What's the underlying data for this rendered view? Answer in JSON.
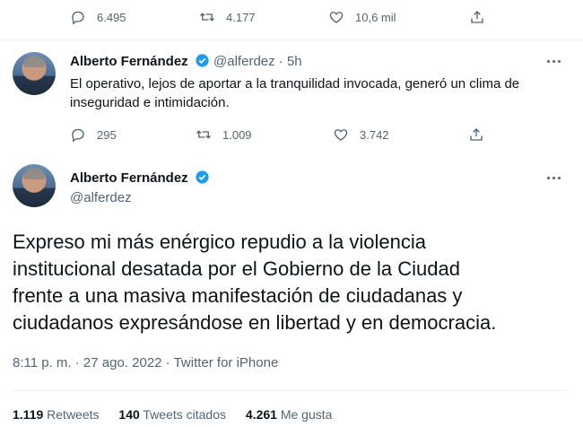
{
  "top_actions": {
    "replies": "6.495",
    "retweets": "4.177",
    "likes": "10,6 mil"
  },
  "reply_tweet": {
    "name": "Alberto Fernández",
    "handle_time": "@alferdez · 5h",
    "text_line1": "El operativo, lejos de aportar a la tranquilidad invocada, generó un clima de",
    "text_line2": "inseguridad e intimidación.",
    "replies": "295",
    "retweets": "1.009",
    "likes": "3.742"
  },
  "main_tweet": {
    "name": "Alberto Fernández",
    "handle": "@alferdez",
    "text_lines": [
      "Expreso mi más enérgico repudio a la violencia",
      "institucional desatada por el Gobierno de la Ciudad",
      "frente a una masiva manifestación de ciudadanas y",
      "ciudadanos expresándose en libertad y en democracia."
    ],
    "timestamp": "8:11 p. m. · 27 ago. 2022 · ",
    "source": "Twitter for iPhone",
    "stats": {
      "retweets_count": "1.119",
      "retweets_label": "Retweets",
      "quotes_count": "140",
      "quotes_label": "Tweets citados",
      "likes_count": "4.261",
      "likes_label": "Me gusta"
    }
  },
  "colors": {
    "verified": "#1d9bf0",
    "muted": "#536471",
    "divider": "#eff3f4"
  }
}
